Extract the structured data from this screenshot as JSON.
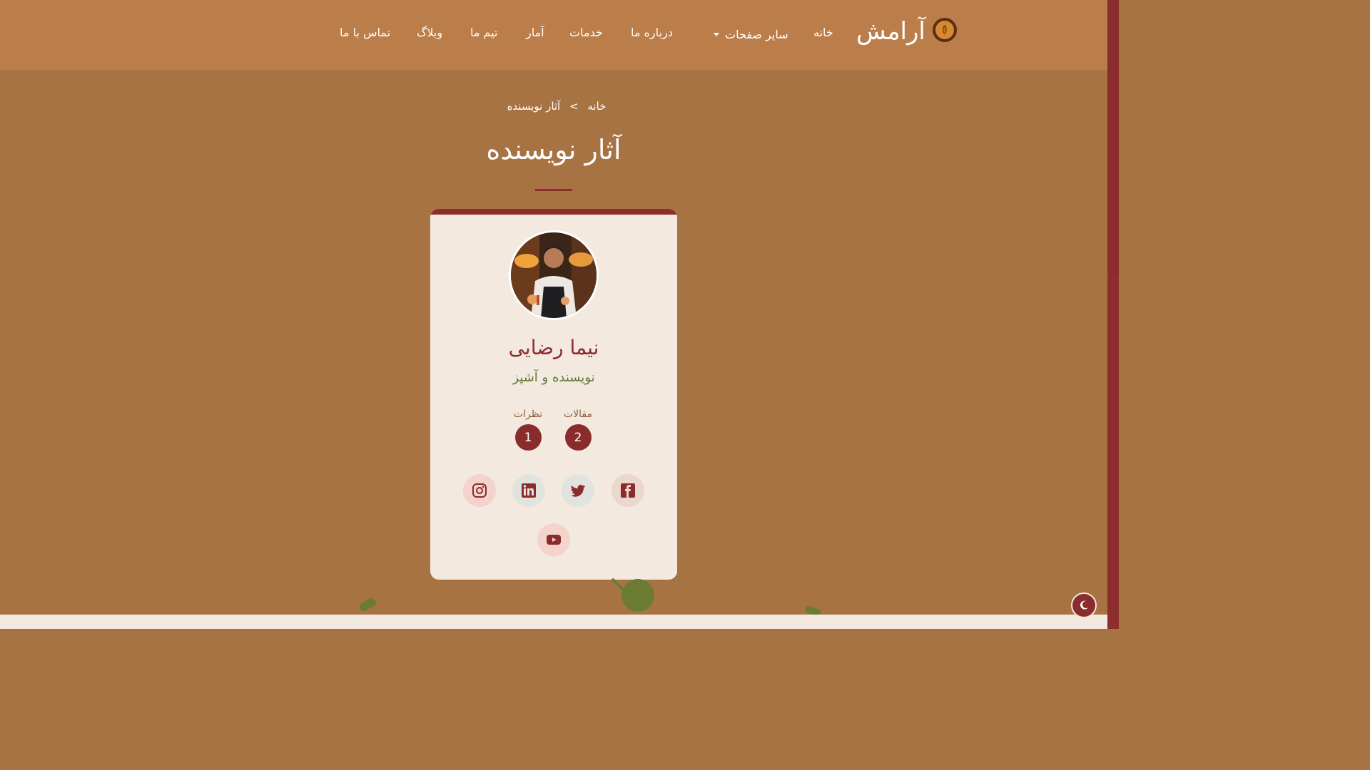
{
  "header": {
    "brand": "آرامش",
    "nav": {
      "home": "خانه",
      "more_pages": "سایر صفحات",
      "about": "درباره ما",
      "services": "خدمات",
      "stats": "آمار",
      "team": "تیم ما",
      "blog": "وبلاگ",
      "contact": "تماس با ما"
    }
  },
  "breadcrumb": {
    "home": "خانه",
    "separator": ">",
    "current": "آثار نویسنده"
  },
  "page_title": "آثار نویسنده",
  "author": {
    "name": "نیما رضایی",
    "role": "نویسنده و آشپز",
    "stats": {
      "articles_label": "مقالات",
      "articles_count": "2",
      "comments_label": "نظرات",
      "comments_count": "1"
    },
    "social_icons": [
      "facebook-icon",
      "twitter-icon",
      "linkedin-icon",
      "instagram-icon",
      "youtube-icon"
    ]
  },
  "colors": {
    "header_bg": "#bb7d49",
    "page_bg": "#a87343",
    "accent": "#8b2c2c",
    "card_bg": "#f4e9df",
    "role_text": "#5f7a3b"
  }
}
